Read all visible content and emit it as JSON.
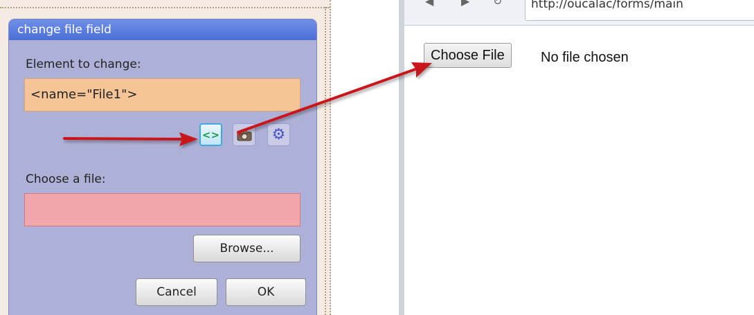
{
  "dialog": {
    "title": "change file field",
    "element_label": "Element to change:",
    "element_value": "<name=\"File1\">",
    "icons": [
      "code-brackets-icon",
      "camera-icon",
      "gear-icon"
    ],
    "code_glyph": "<>",
    "gear_glyph": "⚙",
    "file_label": "Choose a file:",
    "file_value": "",
    "browse_label": "Browse...",
    "cancel_label": "Cancel",
    "ok_label": "OK"
  },
  "browser": {
    "url": "http://oucalac/forms/main",
    "choose_file_label": "Choose File",
    "no_file_text": "No file chosen"
  },
  "colors": {
    "dialog_bg": "#aeb1d7",
    "titlebar": "#4c6fd8",
    "element_field": "#f5c598",
    "file_field": "#f0a6ab",
    "arrow": "#c8151d"
  }
}
